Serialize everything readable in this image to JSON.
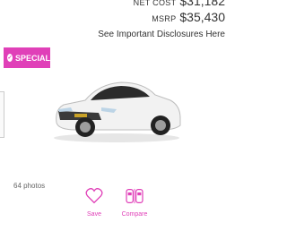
{
  "pricing": {
    "net_cost_label": "NET COST",
    "net_cost_value": "$31,182",
    "msrp_label": "MSRP",
    "msrp_value": "$35,430",
    "disclosure_link": "See Important Disclosures Here"
  },
  "badge": {
    "label": "SPECIAL",
    "icon": "check-circle-icon",
    "color": "#e040b8"
  },
  "gallery": {
    "photo_count": "64 photos"
  },
  "actions": {
    "save_label": "Save",
    "save_icon": "heart-icon",
    "compare_label": "Compare",
    "compare_icon": "car-compare-icon",
    "accent_color": "#e040b8"
  }
}
